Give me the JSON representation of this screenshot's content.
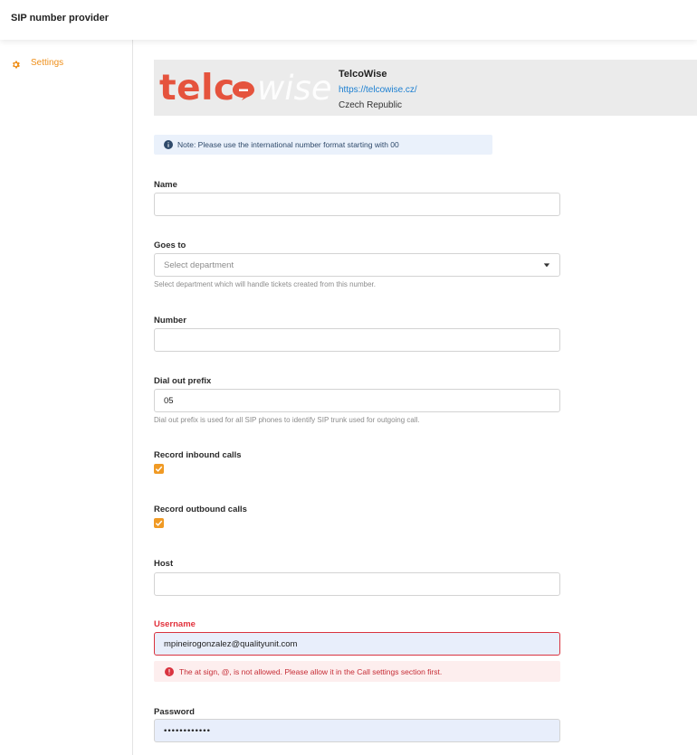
{
  "header": {
    "title": "SIP number provider"
  },
  "sidebar": {
    "items": [
      {
        "label": "Settings",
        "icon": "gear-icon",
        "active": true
      }
    ]
  },
  "provider": {
    "logo_text_main": "telc",
    "logo_text_faded": "wise",
    "name": "TelcoWise",
    "url": "https://telcowise.cz/",
    "country": "Czech Republic"
  },
  "note": {
    "icon": "info-icon",
    "text": "Note: Please use the international number format starting with 00"
  },
  "form": {
    "name": {
      "label": "Name",
      "value": ""
    },
    "goes_to": {
      "label": "Goes to",
      "placeholder": "Select department",
      "help": "Select department which will handle tickets created from this number."
    },
    "number": {
      "label": "Number",
      "value": ""
    },
    "dial_out_prefix": {
      "label": "Dial out prefix",
      "value": "05",
      "help": "Dial out prefix is used for all SIP phones to identify SIP trunk used for outgoing call."
    },
    "record_inbound": {
      "label": "Record inbound calls",
      "checked": true
    },
    "record_outbound": {
      "label": "Record outbound calls",
      "checked": true
    },
    "host": {
      "label": "Host",
      "value": ""
    },
    "username": {
      "label": "Username",
      "value": "mpineirogonzalez@qualityunit.com",
      "error": "The at sign, @, is not allowed. Please allow it in the Call settings section first."
    },
    "password": {
      "label": "Password",
      "value": "••••••••••••"
    }
  },
  "colors": {
    "accent": "#ef8f1a",
    "error": "#e2313c",
    "link": "#1c7fd1",
    "logo_red": "#e5533d"
  }
}
